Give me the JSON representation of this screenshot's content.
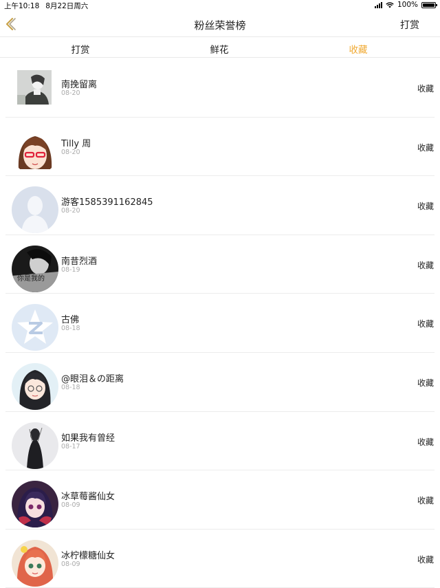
{
  "status": {
    "time": "上午10:18",
    "date": "8月22日周六",
    "battery": "100%",
    "battery_level": 1.0
  },
  "nav": {
    "title": "粉丝荣誉榜",
    "action": "打赏",
    "back_icon": "chevron-left-icon",
    "accent_color": "#c9a34a"
  },
  "tabs": [
    {
      "label": "打赏",
      "active": false
    },
    {
      "label": "鲜花",
      "active": false
    },
    {
      "label": "收藏",
      "active": true
    }
  ],
  "theme": {
    "active_tab_color": "#f0a932",
    "date_color": "#aaaaaa"
  },
  "rows": [
    {
      "name": "南挽留离",
      "date": "08-20",
      "action": "收藏",
      "avatar": "photo-avatar"
    },
    {
      "name": "Tilly 周",
      "date": "08-20",
      "action": "收藏",
      "avatar": "anime-girl-glasses-avatar"
    },
    {
      "name": "游客1585391162845",
      "date": "08-20",
      "action": "收藏",
      "avatar": "default-person-avatar"
    },
    {
      "name": "南昔烈酒",
      "date": "08-19",
      "action": "收藏",
      "avatar": "monochrome-photo-avatar",
      "avatar_text": "你是我的"
    },
    {
      "name": "古佛",
      "date": "08-18",
      "action": "收藏",
      "avatar": "qzone-star-avatar"
    },
    {
      "name": "@眼泪＆の距离",
      "date": "08-18",
      "action": "收藏",
      "avatar": "anime-girl-avatar"
    },
    {
      "name": "如果我有曾经",
      "date": "08-17",
      "action": "收藏",
      "avatar": "dark-figure-avatar"
    },
    {
      "name": "冰草莓酱仙女",
      "date": "08-09",
      "action": "收藏",
      "avatar": "anime-character-avatar"
    },
    {
      "name": "冰柠檬糖仙女",
      "date": "08-09",
      "action": "收藏",
      "avatar": "anime-redhair-avatar"
    }
  ]
}
